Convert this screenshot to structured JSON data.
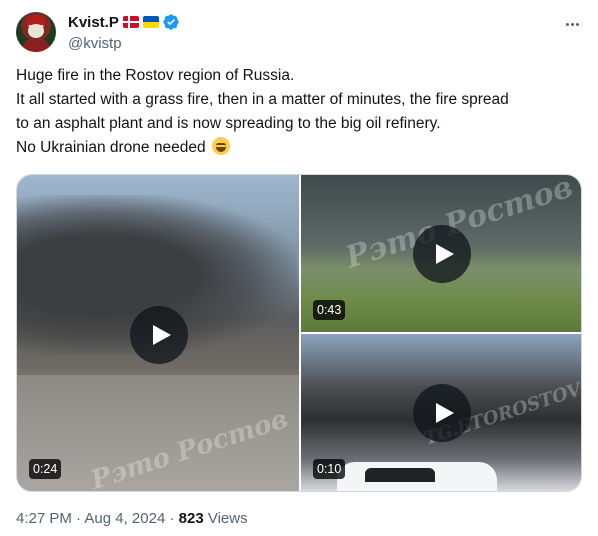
{
  "author": {
    "display_name": "Kvist.P",
    "handle": "@kvistp",
    "flags": [
      "denmark-flag",
      "ukraine-flag"
    ],
    "verified": true
  },
  "tweet": {
    "lines": [
      "Huge fire in the Rostov region of Russia.",
      "It all started with a grass fire, then in a matter of minutes, the fire spread",
      "to an asphalt plant and is now spreading to the big oil refinery.",
      "No Ukrainian drone needed"
    ],
    "emoji": "grinning-squinting-face-emoji"
  },
  "media": {
    "videos": [
      {
        "duration": "0:24",
        "watermark": "Рэто Ростов"
      },
      {
        "duration": "0:43",
        "watermark": "Рэто Ростов"
      },
      {
        "duration": "0:10",
        "watermark": "TG.ETOROSTOV"
      }
    ]
  },
  "meta": {
    "time": "4:27 PM",
    "date": "Aug 4, 2024",
    "separator": "·",
    "views_count": "823",
    "views_label": "Views"
  },
  "colors": {
    "text": "#0f1419",
    "secondary": "#536471",
    "verified_blue": "#1d9bf0",
    "border": "#cfd9de"
  }
}
